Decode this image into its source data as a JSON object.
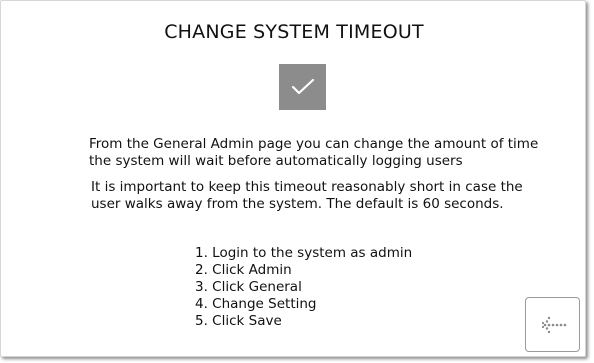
{
  "dialog": {
    "title": "CHANGE SYSTEM TIMEOUT",
    "icon": "checkmark-icon",
    "paragraph_1": "From the General Admin page you can change the amount of time the system will wait before automatically logging users",
    "paragraph_2": "It is important to keep this timeout reasonably short in case the user walks away from the system. The default is 60 seconds.",
    "steps": [
      "1. Login to the system as admin",
      "2. Click Admin",
      "3. Click General",
      "4. Change Setting",
      "5. Click Save"
    ],
    "back_button_icon": "dotted-back-arrow-icon"
  },
  "colors": {
    "check_box_bg": "#8c8c8c",
    "check_mark": "#ffffff",
    "back_arrow": "#8a8a8a"
  }
}
